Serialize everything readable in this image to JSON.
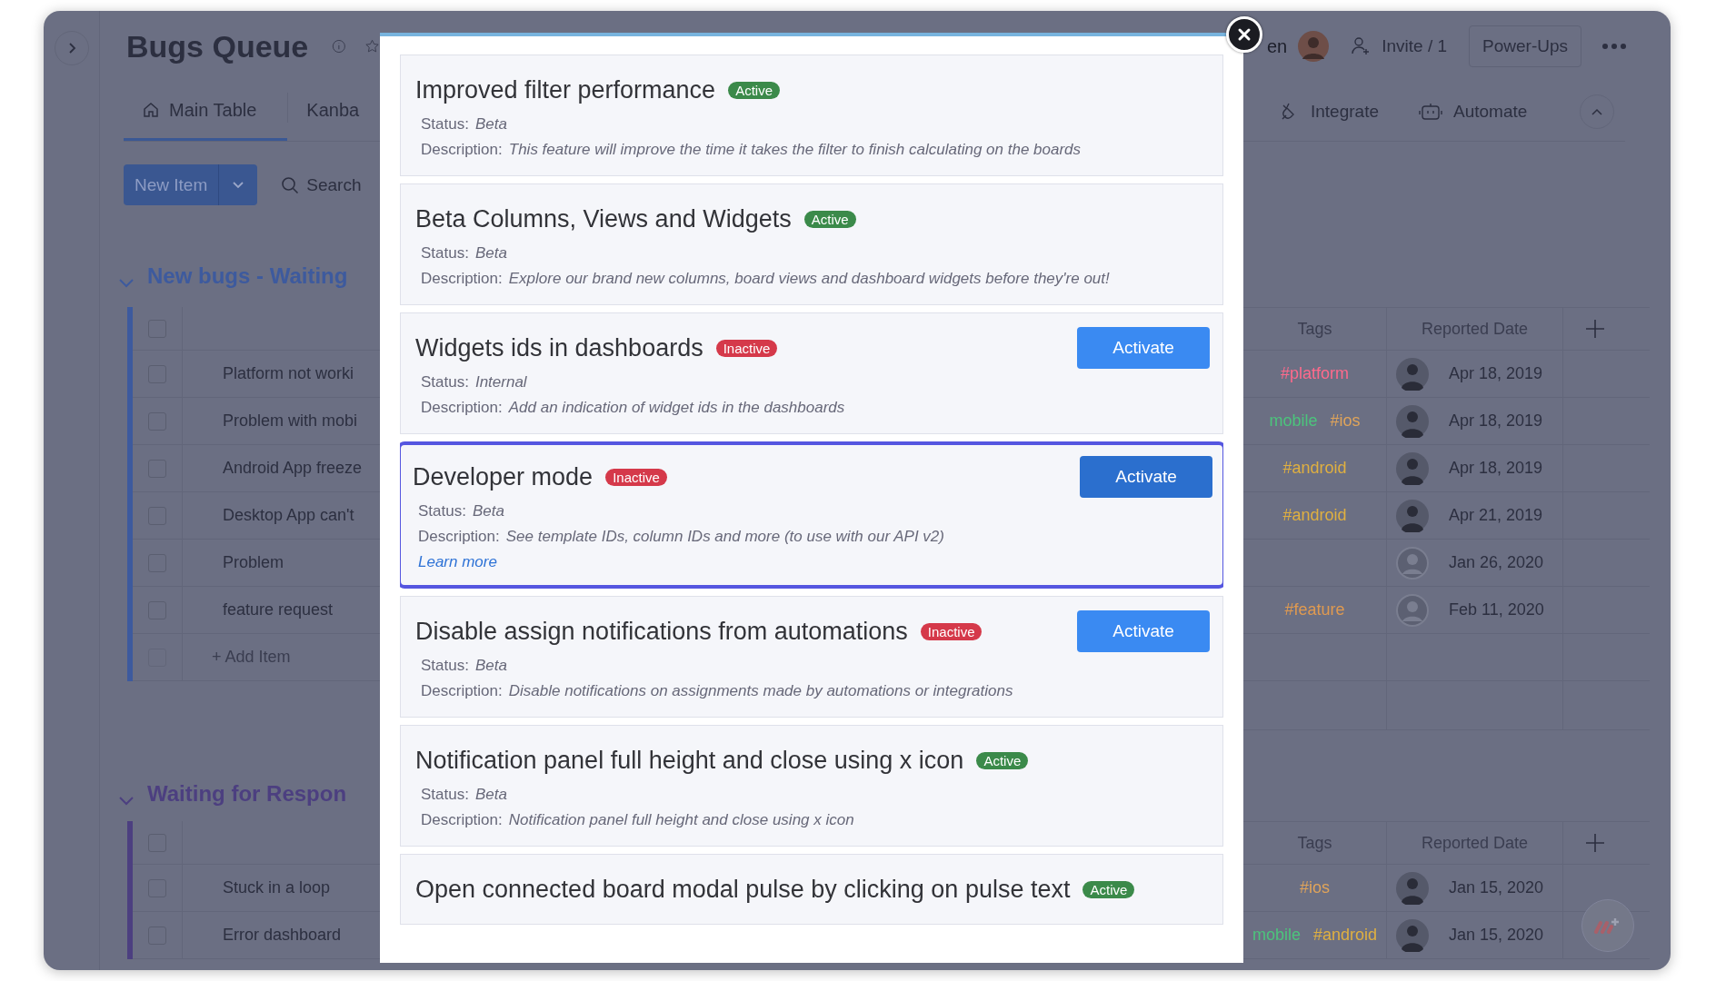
{
  "board": {
    "title": "Bugs Queue",
    "views": [
      {
        "label": "Main Table",
        "kind": "table",
        "selected": true
      },
      {
        "label": "Kanba",
        "kind": "kanban",
        "selected": false
      }
    ],
    "new_item_button": "New Item",
    "search": "Search",
    "viewer_name": "en",
    "invite": "Invite / 1",
    "power_ups": "Power-Ups",
    "integrate": "Integrate",
    "automate": "Automate"
  },
  "groups": [
    {
      "title": "New bugs - Waiting",
      "color": "#3d5a9e",
      "all_checked": false,
      "columns": {
        "tags": "Tags",
        "date": "Reported Date"
      },
      "add_item": "+ Add Item",
      "add_item_checked": false,
      "items": [
        {
          "name": "Platform not worki",
          "kind": "photo",
          "checked": false,
          "tags": [
            {
              "text": "#platform",
              "color": "#ff6a8c"
            }
          ],
          "date": "Apr 18, 2019"
        },
        {
          "name": "Problem with mobi",
          "kind": "photo",
          "checked": false,
          "tags": [
            {
              "text": "mobile",
              "color": "#4cc47c"
            },
            {
              "text": "#ios",
              "color": "#e0a45a"
            }
          ],
          "date": "Apr 18, 2019"
        },
        {
          "name": "Android App freeze",
          "kind": "photo",
          "checked": false,
          "tags": [
            {
              "text": "#android",
              "color": "#e0b040"
            }
          ],
          "date": "Apr 18, 2019"
        },
        {
          "name": "Desktop App can't",
          "kind": "photo",
          "checked": false,
          "tags": [
            {
              "text": "#android",
              "color": "#e0b040"
            }
          ],
          "date": "Apr 21, 2019"
        },
        {
          "name": "Problem",
          "kind": "placeholder",
          "checked": false,
          "date": "Jan 26, 2020"
        },
        {
          "name": "feature request",
          "kind": "placeholder",
          "checked": false,
          "tags": [
            {
              "text": "#feature",
              "color": "#e09a50"
            }
          ],
          "date": "Feb 11, 2020"
        }
      ]
    },
    {
      "title": "Waiting for Respon",
      "color": "#4c3f80",
      "all_checked": false,
      "columns": {
        "tags": "Tags",
        "date": "Reported Date"
      },
      "items": [
        {
          "name": "Stuck in a loop",
          "kind": "photo",
          "checked": false,
          "tags": [
            {
              "text": "#ios",
              "color": "#e0a45a"
            }
          ],
          "date": "Jan 15, 2020"
        },
        {
          "name": "Error dashboard",
          "kind": "photo",
          "checked": false,
          "tags": [
            {
              "text": "mobile",
              "color": "#4cc47c"
            },
            {
              "text": "#android",
              "color": "#e0b040"
            }
          ],
          "date": "Jan 15, 2020"
        }
      ]
    }
  ],
  "modal": {
    "features": [
      {
        "title": "Improved filter performance",
        "active": true,
        "badge": "Active",
        "status_label": "Status:",
        "status": "Beta",
        "description_label": "Description:",
        "description": "This feature will improve the time it takes the filter to finish calculating on the boards",
        "highlighted": false
      },
      {
        "title": "Beta Columns, Views and Widgets",
        "active": true,
        "badge": "Active",
        "status_label": "Status:",
        "status": "Beta",
        "description_label": "Description:",
        "description": "Explore our brand new columns, board views and dashboard widgets before they're out!",
        "highlighted": false
      },
      {
        "title": "Widgets ids in dashboards",
        "active": false,
        "badge": "Inactive",
        "button": "Activate",
        "hovered": false,
        "status_label": "Status:",
        "status": "Internal",
        "description_label": "Description:",
        "description": "Add an indication of widget ids in the dashboards",
        "highlighted": false
      },
      {
        "title": "Developer mode",
        "active": false,
        "badge": "Inactive",
        "button": "Activate",
        "hovered": true,
        "status_label": "Status:",
        "status": "Beta",
        "description_label": "Description:",
        "description": "See template IDs, column IDs and more (to use with our API v2)",
        "link": "Learn more",
        "highlighted": true
      },
      {
        "title": "Disable assign notifications from automations",
        "active": false,
        "badge": "Inactive",
        "button": "Activate",
        "hovered": false,
        "status_label": "Status:",
        "status": "Beta",
        "description_label": "Description:",
        "description": "Disable notifications on assignments made by automations or integrations",
        "highlighted": false
      },
      {
        "title": "Notification panel full height and close using x icon",
        "active": true,
        "badge": "Active",
        "status_label": "Status:",
        "status": "Beta",
        "description_label": "Description:",
        "description": "Notification panel full height and close using x icon",
        "highlighted": false
      },
      {
        "title": "Open connected board modal pulse by clicking on pulse text",
        "active": true,
        "badge": "Active",
        "highlighted": false
      }
    ]
  }
}
